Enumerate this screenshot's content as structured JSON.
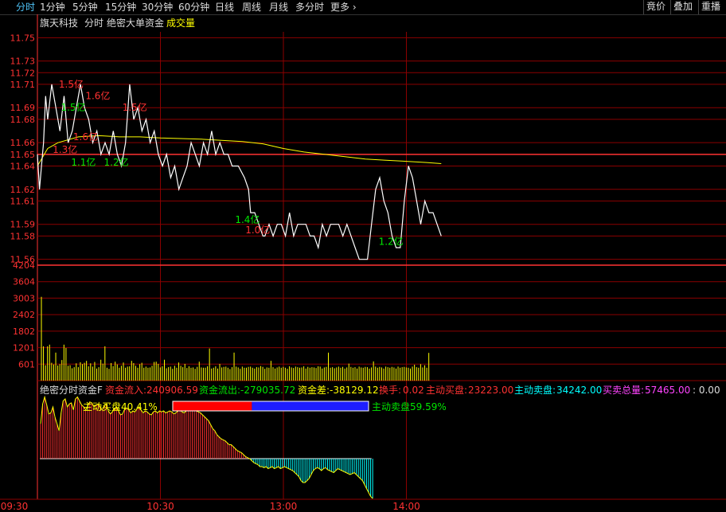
{
  "toolbar": {
    "tabs": [
      "分时",
      "1分钟",
      "5分钟",
      "15分钟",
      "30分钟",
      "60分钟",
      "日线",
      "周线",
      "月线",
      "多分时",
      "更多"
    ],
    "more_chevron": "chevron-right",
    "right_buttons": [
      "竟价",
      "叠加",
      "重播"
    ]
  },
  "header": {
    "stock_name": "旗天科技",
    "mode": "分时",
    "indicator": "绝密大单资金",
    "volume_label": "成交量"
  },
  "colors": {
    "up": "#ff3232",
    "down": "#00e600",
    "price_line": "#ffffff",
    "avg_line": "#ffff00",
    "grid": "#8b0000",
    "axis": "#ff3232",
    "cyan": "#00ffff",
    "magenta": "#ff44ff",
    "blue": "#1e1eff"
  },
  "fund_flow": {
    "title": "绝密分时资金F",
    "inflow_label": "资金流入:",
    "inflow": "240906.59",
    "outflow_label": "资金流出:",
    "outflow": "-279035.72",
    "diff_label": "资金差:",
    "diff": "-38129.12",
    "turnover_label": "换手:",
    "turnover": "0.02",
    "active_buy_label": "主动买盘:",
    "active_buy": "23223.00",
    "active_sell_label": "主动卖盘:",
    "active_sell": "34242.00",
    "total_label": "买卖总量:",
    "total": "57465.00",
    "extra": ": 0.00",
    "buy_ratio_label": "主动买盘40.41%",
    "sell_ratio_label": "主动卖盘59.59%",
    "buy_ratio": 0.4041
  },
  "chart_data": {
    "type": "line",
    "price_axis": {
      "ticks": [
        "11.75",
        "11.73",
        "11.72",
        "11.71",
        "11.69",
        "11.68",
        "11.66",
        "11.65",
        "11.64",
        "11.62",
        "11.61",
        "11.59",
        "11.58",
        "11.56"
      ],
      "prev_close": 11.65,
      "ylim": [
        11.555,
        11.755
      ]
    },
    "volume_axis": {
      "ticks": [
        "4204",
        "3604",
        "3003",
        "2402",
        "1802",
        "1201",
        "601"
      ],
      "ylim": [
        0,
        4204
      ]
    },
    "time_ticks": [
      "09:30",
      "10:30",
      "13:00",
      "14:00"
    ],
    "minutes_total": 240,
    "price_series": [
      [
        0,
        11.65
      ],
      [
        1,
        11.62
      ],
      [
        2,
        11.64
      ],
      [
        3,
        11.66
      ],
      [
        4,
        11.7
      ],
      [
        5,
        11.68
      ],
      [
        7,
        11.71
      ],
      [
        9,
        11.69
      ],
      [
        11,
        11.67
      ],
      [
        13,
        11.7
      ],
      [
        15,
        11.66
      ],
      [
        17,
        11.67
      ],
      [
        19,
        11.69
      ],
      [
        21,
        11.71
      ],
      [
        23,
        11.69
      ],
      [
        25,
        11.68
      ],
      [
        27,
        11.66
      ],
      [
        29,
        11.67
      ],
      [
        31,
        11.65
      ],
      [
        33,
        11.66
      ],
      [
        35,
        11.65
      ],
      [
        37,
        11.67
      ],
      [
        39,
        11.65
      ],
      [
        41,
        11.64
      ],
      [
        43,
        11.66
      ],
      [
        45,
        11.71
      ],
      [
        47,
        11.68
      ],
      [
        49,
        11.69
      ],
      [
        51,
        11.67
      ],
      [
        53,
        11.68
      ],
      [
        55,
        11.66
      ],
      [
        57,
        11.67
      ],
      [
        59,
        11.65
      ],
      [
        61,
        11.64
      ],
      [
        63,
        11.65
      ],
      [
        65,
        11.63
      ],
      [
        67,
        11.64
      ],
      [
        69,
        11.62
      ],
      [
        71,
        11.63
      ],
      [
        73,
        11.64
      ],
      [
        75,
        11.66
      ],
      [
        77,
        11.65
      ],
      [
        79,
        11.64
      ],
      [
        81,
        11.66
      ],
      [
        83,
        11.65
      ],
      [
        85,
        11.67
      ],
      [
        87,
        11.65
      ],
      [
        89,
        11.66
      ],
      [
        91,
        11.65
      ],
      [
        93,
        11.65
      ],
      [
        95,
        11.64
      ],
      [
        98,
        11.64
      ],
      [
        101,
        11.63
      ],
      [
        103,
        11.62
      ],
      [
        104,
        11.6
      ],
      [
        106,
        11.6
      ],
      [
        108,
        11.59
      ],
      [
        110,
        11.58
      ],
      [
        111,
        11.58
      ],
      [
        113,
        11.59
      ],
      [
        115,
        11.58
      ],
      [
        117,
        11.59
      ],
      [
        119,
        11.59
      ],
      [
        121,
        11.58
      ],
      [
        123,
        11.6
      ],
      [
        125,
        11.58
      ],
      [
        127,
        11.59
      ],
      [
        129,
        11.59
      ],
      [
        131,
        11.59
      ],
      [
        133,
        11.58
      ],
      [
        135,
        11.58
      ],
      [
        137,
        11.57
      ],
      [
        139,
        11.59
      ],
      [
        141,
        11.58
      ],
      [
        143,
        11.59
      ],
      [
        145,
        11.59
      ],
      [
        147,
        11.59
      ],
      [
        149,
        11.58
      ],
      [
        151,
        11.59
      ],
      [
        153,
        11.58
      ],
      [
        155,
        11.57
      ],
      [
        157,
        11.56
      ],
      [
        161,
        11.56
      ],
      [
        163,
        11.59
      ],
      [
        165,
        11.62
      ],
      [
        167,
        11.63
      ],
      [
        169,
        11.61
      ],
      [
        171,
        11.6
      ],
      [
        173,
        11.58
      ],
      [
        175,
        11.57
      ],
      [
        177,
        11.57
      ],
      [
        179,
        11.61
      ],
      [
        181,
        11.64
      ],
      [
        183,
        11.63
      ],
      [
        185,
        11.61
      ],
      [
        187,
        11.59
      ],
      [
        189,
        11.61
      ],
      [
        191,
        11.6
      ],
      [
        193,
        11.6
      ],
      [
        195,
        11.59
      ],
      [
        197,
        11.58
      ]
    ],
    "avg_series": [
      [
        0,
        11.64
      ],
      [
        5,
        11.655
      ],
      [
        10,
        11.66
      ],
      [
        20,
        11.665
      ],
      [
        30,
        11.666
      ],
      [
        40,
        11.665
      ],
      [
        50,
        11.665
      ],
      [
        60,
        11.664
      ],
      [
        80,
        11.663
      ],
      [
        100,
        11.661
      ],
      [
        110,
        11.659
      ],
      [
        120,
        11.655
      ],
      [
        130,
        11.652
      ],
      [
        140,
        11.65
      ],
      [
        150,
        11.648
      ],
      [
        160,
        11.646
      ],
      [
        170,
        11.645
      ],
      [
        180,
        11.644
      ],
      [
        190,
        11.643
      ],
      [
        197,
        11.642
      ]
    ],
    "annotations": [
      {
        "t": 5,
        "p": 11.71,
        "text": "1.5亿",
        "color": "#ff3232"
      },
      {
        "t": 18,
        "p": 11.7,
        "text": "1.6亿",
        "color": "#ff3232"
      },
      {
        "t": 6,
        "p": 11.69,
        "text": "1.5亿",
        "color": "#00e600"
      },
      {
        "t": 36,
        "p": 11.69,
        "text": "1.5亿",
        "color": "#ff3232"
      },
      {
        "t": 12,
        "p": 11.665,
        "text": "1.6亿",
        "color": "#ff3232"
      },
      {
        "t": 2,
        "p": 11.654,
        "text": "1.3亿",
        "color": "#ff3232"
      },
      {
        "t": 11,
        "p": 11.643,
        "text": "1.1亿",
        "color": "#00e600"
      },
      {
        "t": 27,
        "p": 11.643,
        "text": "1.2亿",
        "color": "#00e600"
      },
      {
        "t": 91,
        "p": 11.594,
        "text": "1.4亿",
        "color": "#00e600"
      },
      {
        "t": 96,
        "p": 11.585,
        "text": "1.0亿",
        "color": "#ff3232"
      },
      {
        "t": 161,
        "p": 11.575,
        "text": "1.2亿",
        "color": "#00e600"
      }
    ],
    "volume_bars": [
      3050,
      1250,
      560,
      1250,
      1310,
      650,
      590,
      1020,
      550,
      600,
      750,
      1310,
      1190,
      540,
      560,
      450,
      490,
      630,
      490,
      670,
      600,
      650,
      720,
      520,
      630,
      510,
      680,
      440,
      490,
      760,
      620,
      1250,
      470,
      430,
      640,
      530,
      690,
      590,
      470,
      540,
      660,
      470,
      510,
      520,
      720,
      640,
      540,
      470,
      600,
      650,
      470,
      510,
      470,
      480,
      540,
      680,
      690,
      610,
      480,
      520,
      760,
      450,
      490,
      510,
      430,
      540,
      470,
      660,
      540,
      490,
      610,
      460,
      520,
      470,
      480,
      430,
      500,
      690,
      480,
      470,
      470,
      520,
      1170,
      440,
      470,
      520,
      440,
      610,
      480,
      500,
      510,
      470,
      420,
      490,
      1020,
      510,
      480,
      430,
      510,
      470,
      470,
      500,
      510,
      470,
      440,
      490,
      480,
      530,
      500,
      430,
      480,
      470,
      720,
      490,
      440,
      480,
      510,
      470,
      500,
      470,
      430,
      520,
      480,
      460,
      510,
      490,
      470,
      480,
      520,
      440,
      500,
      470,
      490,
      480,
      460,
      520,
      510,
      440,
      480,
      500,
      1020,
      470,
      490,
      450,
      480,
      510,
      470,
      500,
      440,
      480,
      620,
      500,
      470,
      490,
      440,
      510,
      480,
      470,
      500,
      490,
      440,
      480,
      700,
      510,
      470,
      500,
      480,
      440,
      510,
      490,
      470,
      500,
      480,
      440,
      510,
      470,
      490,
      500,
      480,
      470,
      440,
      510,
      580,
      490,
      470,
      600,
      480,
      560,
      470,
      1010
    ],
    "fund_series": [
      35,
      55,
      62,
      54,
      45,
      46,
      52,
      42,
      35,
      28,
      46,
      58,
      60,
      52,
      55,
      56,
      49,
      60,
      62,
      58,
      54,
      52,
      49,
      53,
      57,
      56,
      52,
      54,
      55,
      52,
      49,
      53,
      55,
      48,
      45,
      47,
      50,
      52,
      48,
      44,
      45,
      50,
      51,
      49,
      46,
      48,
      47,
      50,
      52,
      49,
      46,
      48,
      47,
      45,
      44,
      47,
      48,
      46,
      48,
      47,
      48,
      46,
      47,
      48,
      47,
      45,
      46,
      48,
      49,
      47,
      46,
      48,
      49,
      50,
      51,
      49,
      48,
      47,
      46,
      44,
      42,
      40,
      38,
      34,
      30,
      28,
      24,
      22,
      20,
      19,
      18,
      16,
      14,
      14,
      12,
      10,
      8,
      7,
      6,
      4,
      2,
      1,
      0,
      -2,
      -4,
      -5,
      -6,
      -8,
      -8,
      -9,
      -8,
      -10,
      -9,
      -8,
      -10,
      -9,
      -8,
      -10,
      -9,
      -8,
      -9,
      -10,
      -11,
      -12,
      -14,
      -16,
      -18,
      -22,
      -24,
      -24,
      -22,
      -20,
      -16,
      -12,
      -10,
      -9,
      -10,
      -12,
      -10,
      -9,
      -11,
      -12,
      -13,
      -14,
      -12,
      -10,
      -11,
      -12,
      -13,
      -14,
      -15,
      -16,
      -15,
      -14,
      -16,
      -18,
      -20,
      -22,
      -26,
      -30,
      -34,
      -38,
      -40
    ]
  }
}
